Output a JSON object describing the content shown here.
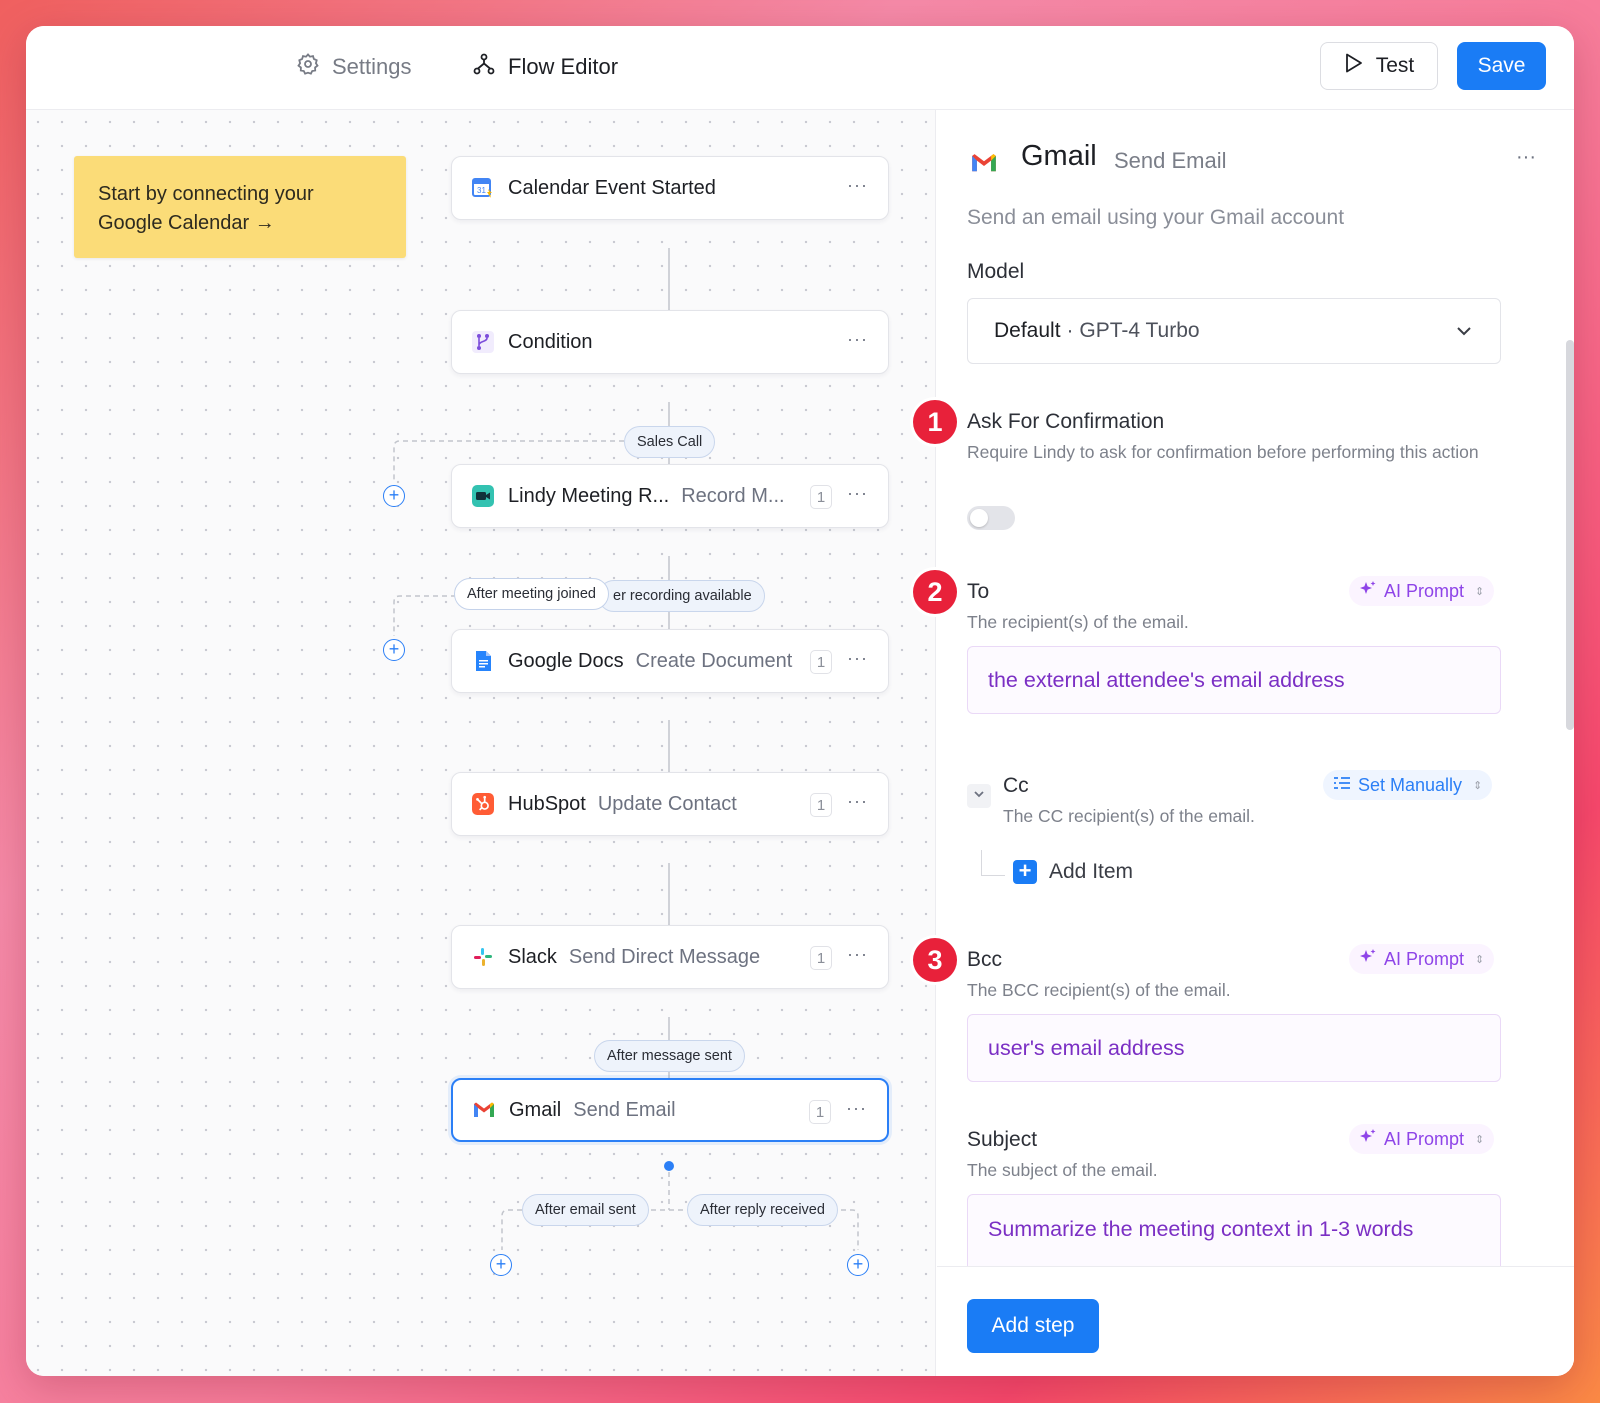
{
  "header": {
    "tabs": [
      {
        "label": "Settings",
        "icon": "gear-icon"
      },
      {
        "label": "Flow Editor",
        "icon": "flow-icon"
      }
    ],
    "test_label": "Test",
    "save_label": "Save"
  },
  "canvas": {
    "sticky_note": "Start by connecting your Google Calendar →",
    "nodes": [
      {
        "title": "Calendar Event Started",
        "subtitle": "",
        "count": "",
        "icon": "google-calendar-icon"
      },
      {
        "title": "Condition",
        "subtitle": "",
        "count": "",
        "icon": "branch-icon"
      },
      {
        "title": "Lindy Meeting R...",
        "subtitle": "Record M...",
        "count": "1",
        "icon": "video-camera-icon"
      },
      {
        "title": "Google Docs",
        "subtitle": "Create Document",
        "count": "1",
        "icon": "google-docs-icon"
      },
      {
        "title": "HubSpot",
        "subtitle": "Update Contact",
        "count": "1",
        "icon": "hubspot-icon"
      },
      {
        "title": "Slack",
        "subtitle": "Send Direct Message",
        "count": "1",
        "icon": "slack-icon"
      },
      {
        "title": "Gmail",
        "subtitle": "Send Email",
        "count": "1",
        "icon": "gmail-icon"
      }
    ],
    "pills": {
      "sales_call": "Sales Call",
      "after_meeting_joined": "After meeting joined",
      "after_recording": "er recording available",
      "after_message_sent": "After message sent",
      "after_email_sent": "After email sent",
      "after_reply_received": "After reply received"
    },
    "menu_glyph": "···"
  },
  "panel": {
    "app": "Gmail",
    "action": "Send Email",
    "description": "Send an email using your Gmail account",
    "model": {
      "label": "Model",
      "value_strong": "Default",
      "value_rest": "· GPT-4 Turbo"
    },
    "confirmation": {
      "badge": "1",
      "label": "Ask For Confirmation",
      "description": "Require Lindy to ask for confirmation before performing this action",
      "enabled": false
    },
    "to": {
      "badge": "2",
      "label": "To",
      "description": "The recipient(s) of the email.",
      "mode": "AI Prompt",
      "value": "the external attendee's email address"
    },
    "cc": {
      "label": "Cc",
      "description": "The CC recipient(s) of the email.",
      "mode": "Set Manually",
      "add_item": "Add Item"
    },
    "bcc": {
      "badge": "3",
      "label": "Bcc",
      "description": "The BCC recipient(s) of the email.",
      "mode": "AI Prompt",
      "value": "user's email address"
    },
    "subject": {
      "label": "Subject",
      "description": "The subject of the email.",
      "mode": "AI Prompt",
      "value": "Summarize the meeting context in 1-3 words"
    },
    "add_step_label": "Add step"
  },
  "colors": {
    "accent_blue": "#1a7cf5",
    "ai_purple": "#8e44e8",
    "badge_red": "#e8213a",
    "sticky_yellow": "#fbdc78"
  }
}
